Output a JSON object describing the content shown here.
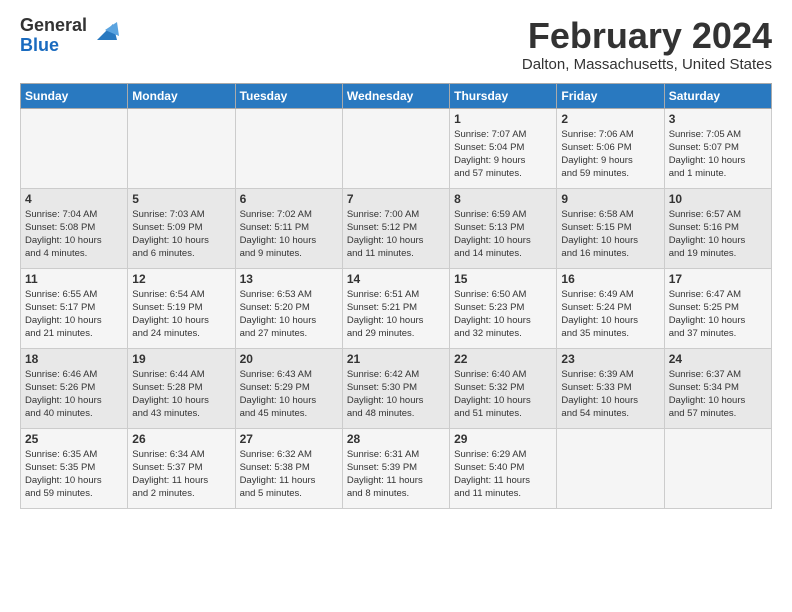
{
  "logo": {
    "general": "General",
    "blue": "Blue"
  },
  "title": "February 2024",
  "location": "Dalton, Massachusetts, United States",
  "headers": [
    "Sunday",
    "Monday",
    "Tuesday",
    "Wednesday",
    "Thursday",
    "Friday",
    "Saturday"
  ],
  "weeks": [
    [
      {
        "day": "",
        "info": ""
      },
      {
        "day": "",
        "info": ""
      },
      {
        "day": "",
        "info": ""
      },
      {
        "day": "",
        "info": ""
      },
      {
        "day": "1",
        "info": "Sunrise: 7:07 AM\nSunset: 5:04 PM\nDaylight: 9 hours\nand 57 minutes."
      },
      {
        "day": "2",
        "info": "Sunrise: 7:06 AM\nSunset: 5:06 PM\nDaylight: 9 hours\nand 59 minutes."
      },
      {
        "day": "3",
        "info": "Sunrise: 7:05 AM\nSunset: 5:07 PM\nDaylight: 10 hours\nand 1 minute."
      }
    ],
    [
      {
        "day": "4",
        "info": "Sunrise: 7:04 AM\nSunset: 5:08 PM\nDaylight: 10 hours\nand 4 minutes."
      },
      {
        "day": "5",
        "info": "Sunrise: 7:03 AM\nSunset: 5:09 PM\nDaylight: 10 hours\nand 6 minutes."
      },
      {
        "day": "6",
        "info": "Sunrise: 7:02 AM\nSunset: 5:11 PM\nDaylight: 10 hours\nand 9 minutes."
      },
      {
        "day": "7",
        "info": "Sunrise: 7:00 AM\nSunset: 5:12 PM\nDaylight: 10 hours\nand 11 minutes."
      },
      {
        "day": "8",
        "info": "Sunrise: 6:59 AM\nSunset: 5:13 PM\nDaylight: 10 hours\nand 14 minutes."
      },
      {
        "day": "9",
        "info": "Sunrise: 6:58 AM\nSunset: 5:15 PM\nDaylight: 10 hours\nand 16 minutes."
      },
      {
        "day": "10",
        "info": "Sunrise: 6:57 AM\nSunset: 5:16 PM\nDaylight: 10 hours\nand 19 minutes."
      }
    ],
    [
      {
        "day": "11",
        "info": "Sunrise: 6:55 AM\nSunset: 5:17 PM\nDaylight: 10 hours\nand 21 minutes."
      },
      {
        "day": "12",
        "info": "Sunrise: 6:54 AM\nSunset: 5:19 PM\nDaylight: 10 hours\nand 24 minutes."
      },
      {
        "day": "13",
        "info": "Sunrise: 6:53 AM\nSunset: 5:20 PM\nDaylight: 10 hours\nand 27 minutes."
      },
      {
        "day": "14",
        "info": "Sunrise: 6:51 AM\nSunset: 5:21 PM\nDaylight: 10 hours\nand 29 minutes."
      },
      {
        "day": "15",
        "info": "Sunrise: 6:50 AM\nSunset: 5:23 PM\nDaylight: 10 hours\nand 32 minutes."
      },
      {
        "day": "16",
        "info": "Sunrise: 6:49 AM\nSunset: 5:24 PM\nDaylight: 10 hours\nand 35 minutes."
      },
      {
        "day": "17",
        "info": "Sunrise: 6:47 AM\nSunset: 5:25 PM\nDaylight: 10 hours\nand 37 minutes."
      }
    ],
    [
      {
        "day": "18",
        "info": "Sunrise: 6:46 AM\nSunset: 5:26 PM\nDaylight: 10 hours\nand 40 minutes."
      },
      {
        "day": "19",
        "info": "Sunrise: 6:44 AM\nSunset: 5:28 PM\nDaylight: 10 hours\nand 43 minutes."
      },
      {
        "day": "20",
        "info": "Sunrise: 6:43 AM\nSunset: 5:29 PM\nDaylight: 10 hours\nand 45 minutes."
      },
      {
        "day": "21",
        "info": "Sunrise: 6:42 AM\nSunset: 5:30 PM\nDaylight: 10 hours\nand 48 minutes."
      },
      {
        "day": "22",
        "info": "Sunrise: 6:40 AM\nSunset: 5:32 PM\nDaylight: 10 hours\nand 51 minutes."
      },
      {
        "day": "23",
        "info": "Sunrise: 6:39 AM\nSunset: 5:33 PM\nDaylight: 10 hours\nand 54 minutes."
      },
      {
        "day": "24",
        "info": "Sunrise: 6:37 AM\nSunset: 5:34 PM\nDaylight: 10 hours\nand 57 minutes."
      }
    ],
    [
      {
        "day": "25",
        "info": "Sunrise: 6:35 AM\nSunset: 5:35 PM\nDaylight: 10 hours\nand 59 minutes."
      },
      {
        "day": "26",
        "info": "Sunrise: 6:34 AM\nSunset: 5:37 PM\nDaylight: 11 hours\nand 2 minutes."
      },
      {
        "day": "27",
        "info": "Sunrise: 6:32 AM\nSunset: 5:38 PM\nDaylight: 11 hours\nand 5 minutes."
      },
      {
        "day": "28",
        "info": "Sunrise: 6:31 AM\nSunset: 5:39 PM\nDaylight: 11 hours\nand 8 minutes."
      },
      {
        "day": "29",
        "info": "Sunrise: 6:29 AM\nSunset: 5:40 PM\nDaylight: 11 hours\nand 11 minutes."
      },
      {
        "day": "",
        "info": ""
      },
      {
        "day": "",
        "info": ""
      }
    ]
  ]
}
